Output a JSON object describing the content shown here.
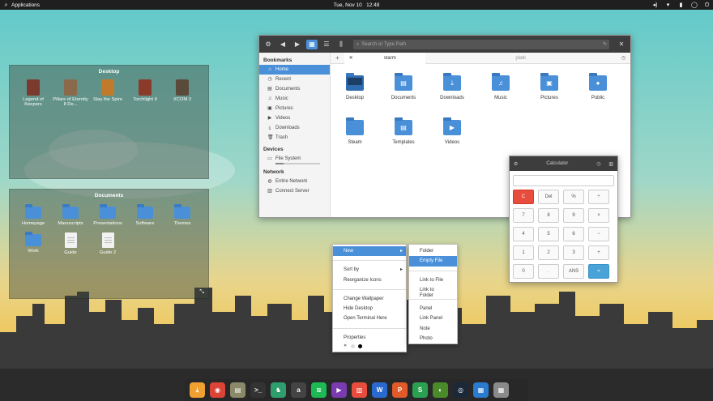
{
  "top_panel": {
    "applications_label": "Applications",
    "date": "Tue, Nov 10",
    "time": "12:49"
  },
  "desktop_widget": {
    "title": "Desktop",
    "items": [
      {
        "label": "Legend of Keepers",
        "color": "#7a3b2e"
      },
      {
        "label": "Pillars of Eternity II De...",
        "color": "#8a6a4a"
      },
      {
        "label": "Slay the Spire",
        "color": "#c07a2a"
      },
      {
        "label": "Torchlight II",
        "color": "#8b3a2a"
      },
      {
        "label": "XCOM 2",
        "color": "#5a4a3a"
      }
    ]
  },
  "documents_widget": {
    "title": "Documents",
    "items": [
      {
        "label": "Homepage",
        "kind": "folder"
      },
      {
        "label": "Manuscripts",
        "kind": "folder"
      },
      {
        "label": "Presentations",
        "kind": "folder"
      },
      {
        "label": "Software",
        "kind": "folder"
      },
      {
        "label": "Themes",
        "kind": "folder"
      },
      {
        "label": "Work",
        "kind": "folder"
      },
      {
        "label": "Guide",
        "kind": "doc"
      },
      {
        "label": "Guide 2",
        "kind": "doc"
      }
    ]
  },
  "file_manager": {
    "search_placeholder": "Search or Type Path",
    "bookmarks_header": "Bookmarks",
    "bookmarks": [
      {
        "label": "Home",
        "icon": "home-icon",
        "glyph": "⌂"
      },
      {
        "label": "Recent",
        "icon": "clock-icon",
        "glyph": "◷"
      },
      {
        "label": "Documents",
        "icon": "document-icon",
        "glyph": "▤"
      },
      {
        "label": "Music",
        "icon": "music-icon",
        "glyph": "♫"
      },
      {
        "label": "Pictures",
        "icon": "picture-icon",
        "glyph": "▣"
      },
      {
        "label": "Videos",
        "icon": "video-icon",
        "glyph": "▶"
      },
      {
        "label": "Downloads",
        "icon": "download-icon",
        "glyph": "⤓"
      },
      {
        "label": "Trash",
        "icon": "trash-icon",
        "glyph": "🗑"
      }
    ],
    "devices_header": "Devices",
    "devices": [
      {
        "label": "File System",
        "icon": "drive-icon",
        "glyph": "▭"
      }
    ],
    "network_header": "Network",
    "network": [
      {
        "label": "Entire Network",
        "icon": "globe-icon",
        "glyph": "◍"
      },
      {
        "label": "Connect Server",
        "icon": "server-icon",
        "glyph": "▥"
      }
    ],
    "tabs": [
      {
        "label": "starm"
      },
      {
        "label": "platk"
      }
    ],
    "items": [
      {
        "label": "Desktop",
        "glyph": "",
        "dark": true
      },
      {
        "label": "Documents",
        "glyph": "▤",
        "dark": false
      },
      {
        "label": "Downloads",
        "glyph": "⤓",
        "dark": false
      },
      {
        "label": "Music",
        "glyph": "♫",
        "dark": false
      },
      {
        "label": "Pictures",
        "glyph": "▣",
        "dark": false
      },
      {
        "label": "Public",
        "glyph": "●",
        "dark": false
      },
      {
        "label": "Steam",
        "glyph": "",
        "dark": false
      },
      {
        "label": "Templates",
        "glyph": "▤",
        "dark": false
      },
      {
        "label": "Videos",
        "glyph": "▶",
        "dark": false
      }
    ]
  },
  "calculator": {
    "title": "Calculator",
    "keys": [
      "C",
      "Del",
      "%",
      "÷",
      "7",
      "8",
      "9",
      "×",
      "4",
      "5",
      "6",
      "−",
      "1",
      "2",
      "3",
      "+",
      "0",
      ".",
      "ANS",
      "="
    ]
  },
  "context_menu": {
    "items": [
      {
        "label": "New",
        "submenu": true,
        "highlight": true
      },
      {
        "sep": true
      },
      {
        "label": "Sort by",
        "submenu": true
      },
      {
        "label": "Reorganize Icons"
      },
      {
        "sep": true
      },
      {
        "label": "Change Wallpaper"
      },
      {
        "label": "Hide Desktop"
      },
      {
        "label": "Open Terminal Here"
      },
      {
        "sep": true
      },
      {
        "label": "Properties"
      }
    ],
    "colors": [
      "#ffffff",
      "#dddddd",
      "#000000"
    ]
  },
  "new_submenu": {
    "items": [
      {
        "label": "Folder"
      },
      {
        "label": "Empty File",
        "highlight": true
      },
      {
        "sep": true
      },
      {
        "label": "Link to File"
      },
      {
        "label": "Link to Folder"
      },
      {
        "sep": true
      },
      {
        "label": "Panel"
      },
      {
        "label": "Link Panel"
      },
      {
        "label": "Note"
      },
      {
        "label": "Photo"
      }
    ]
  },
  "dock": {
    "items": [
      {
        "name": "download-manager-icon",
        "color": "#f0a030",
        "glyph": "⤓"
      },
      {
        "name": "chrome-icon",
        "color": "#db4437",
        "glyph": "◉"
      },
      {
        "name": "files-icon",
        "color": "#8a8a6a",
        "glyph": "▤"
      },
      {
        "name": "terminal-icon",
        "color": "#333333",
        "glyph": ">_"
      },
      {
        "name": "store-icon",
        "color": "#2e9e6e",
        "glyph": "♞"
      },
      {
        "name": "a-app-icon",
        "color": "#444444",
        "glyph": "a"
      },
      {
        "name": "spotify-icon",
        "color": "#1db954",
        "glyph": "≋"
      },
      {
        "name": "media-icon",
        "color": "#7a3ab0",
        "glyph": "▶"
      },
      {
        "name": "presentation-icon",
        "color": "#e74c3c",
        "glyph": "▥"
      },
      {
        "name": "writer-icon",
        "color": "#2a6ad0",
        "glyph": "W"
      },
      {
        "name": "wps-icon",
        "color": "#e05a2a",
        "glyph": "P"
      },
      {
        "name": "sheets-icon",
        "color": "#2aa050",
        "glyph": "S"
      },
      {
        "name": "nvidia-icon",
        "color": "#4a8a2a",
        "glyph": "◐"
      },
      {
        "name": "steam-icon",
        "color": "#1b2838",
        "glyph": "◎"
      },
      {
        "name": "workspace-icon",
        "color": "#2a7ad0",
        "glyph": "▦"
      },
      {
        "name": "calculator-dock-icon",
        "color": "#8a8a8a",
        "glyph": "▦"
      }
    ]
  }
}
